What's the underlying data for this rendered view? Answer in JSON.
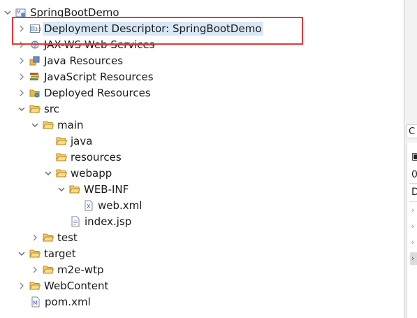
{
  "tree": {
    "project": "SpringBootDemo",
    "deployment_descriptor": "Deployment Descriptor: SpringBootDemo",
    "jax_ws": "JAX-WS Web Services",
    "java_resources": "Java Resources",
    "javascript_resources": "JavaScript Resources",
    "deployed_resources": "Deployed Resources",
    "src": "src",
    "main": "main",
    "java": "java",
    "resources": "resources",
    "webapp": "webapp",
    "web_inf": "WEB-INF",
    "web_xml": "web.xml",
    "index_jsp": "index.jsp",
    "test": "test",
    "target": "target",
    "m2e_wtp": "m2e-wtp",
    "webcontent": "WebContent",
    "pom_xml": "pom.xml"
  },
  "right_panel": {
    "tab_letter": "C",
    "count": "0",
    "letter_d": "D"
  },
  "colors": {
    "selection": "#d9e8f7",
    "highlight_box": "#e23b3b",
    "folder": "#e8b84a"
  }
}
